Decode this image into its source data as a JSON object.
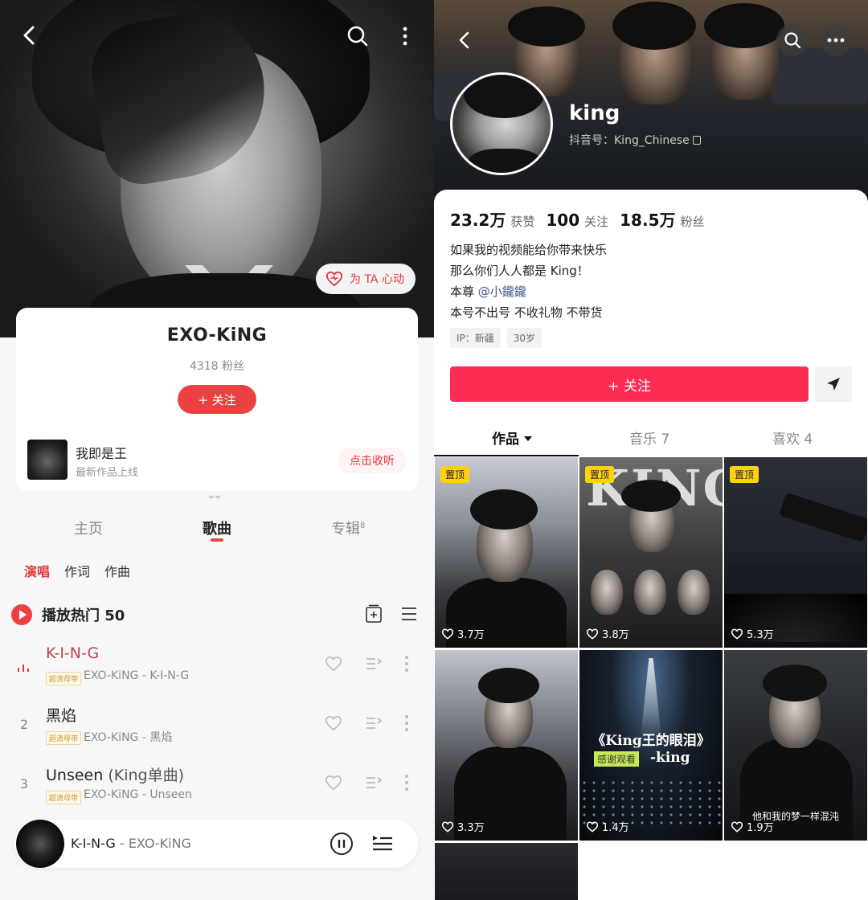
{
  "left": {
    "artist": {
      "name": "EXO-KiNG",
      "fans": "4318 粉丝",
      "follow_label": "+ 关注"
    },
    "heart_pill": "为 TA 心动",
    "latest": {
      "title": "我即是王",
      "subtitle": "最新作品上线",
      "action": "点击收听"
    },
    "tabs": [
      {
        "label": "主页"
      },
      {
        "label": "歌曲"
      },
      {
        "label": "专辑",
        "count": "8"
      }
    ],
    "filters": [
      "演唱",
      "作词",
      "作曲"
    ],
    "play_hot": "播放热门 50",
    "songs": [
      {
        "num": "",
        "title": "K-I-N-G",
        "sub": "",
        "badge": "超清母带",
        "meta": "EXO-KiNG - K-I-N-G"
      },
      {
        "num": "2",
        "title": "黑焰",
        "sub": "",
        "badge": "超清母带",
        "meta": "EXO-KiNG - 黑焰"
      },
      {
        "num": "3",
        "title": "Unseen",
        "sub": "(King单曲)",
        "badge": "超清母带",
        "meta": "EXO-KiNG - Unseen"
      }
    ],
    "player": {
      "title": "K-I-N-G",
      "sep": " - ",
      "artist": "EXO-KiNG"
    }
  },
  "right": {
    "nickname": "king",
    "douyin_id": "抖音号：King_Chinese",
    "stats": [
      {
        "value": "23.2万",
        "key": "获赞"
      },
      {
        "value": "100",
        "key": "关注"
      },
      {
        "value": "18.5万",
        "key": "粉丝"
      }
    ],
    "bio": [
      "如果我的视频能给你带来快乐",
      "那么你们人人都是 King！",
      "本尊 ",
      "本号不出号 不收礼物 不带货"
    ],
    "bio_mention": "@小鑨鑨",
    "tags": [
      "IP：新疆",
      "30岁"
    ],
    "follow_label": "+ 关注",
    "tabs": [
      {
        "label": "作品"
      },
      {
        "label": "音乐 7"
      },
      {
        "label": "喜欢 4"
      }
    ],
    "videos": [
      {
        "pinned": "置顶",
        "likes": "3.7万"
      },
      {
        "pinned": "置顶",
        "likes": "3.8万",
        "text": "KING"
      },
      {
        "pinned": "置顶",
        "likes": "5.3万"
      },
      {
        "pinned": "",
        "likes": "3.3万"
      },
      {
        "pinned": "",
        "likes": "1.4万",
        "text": "《King王的眼泪》",
        "text2": "感谢观看",
        "text3": "-king"
      },
      {
        "pinned": "",
        "likes": "1.9万",
        "caption": "他和我的梦一样混沌"
      }
    ]
  },
  "colors": {
    "music_red": "#ec4141",
    "douyin_pink": "#fe2c55",
    "pin_yellow": "#fdd10f"
  }
}
